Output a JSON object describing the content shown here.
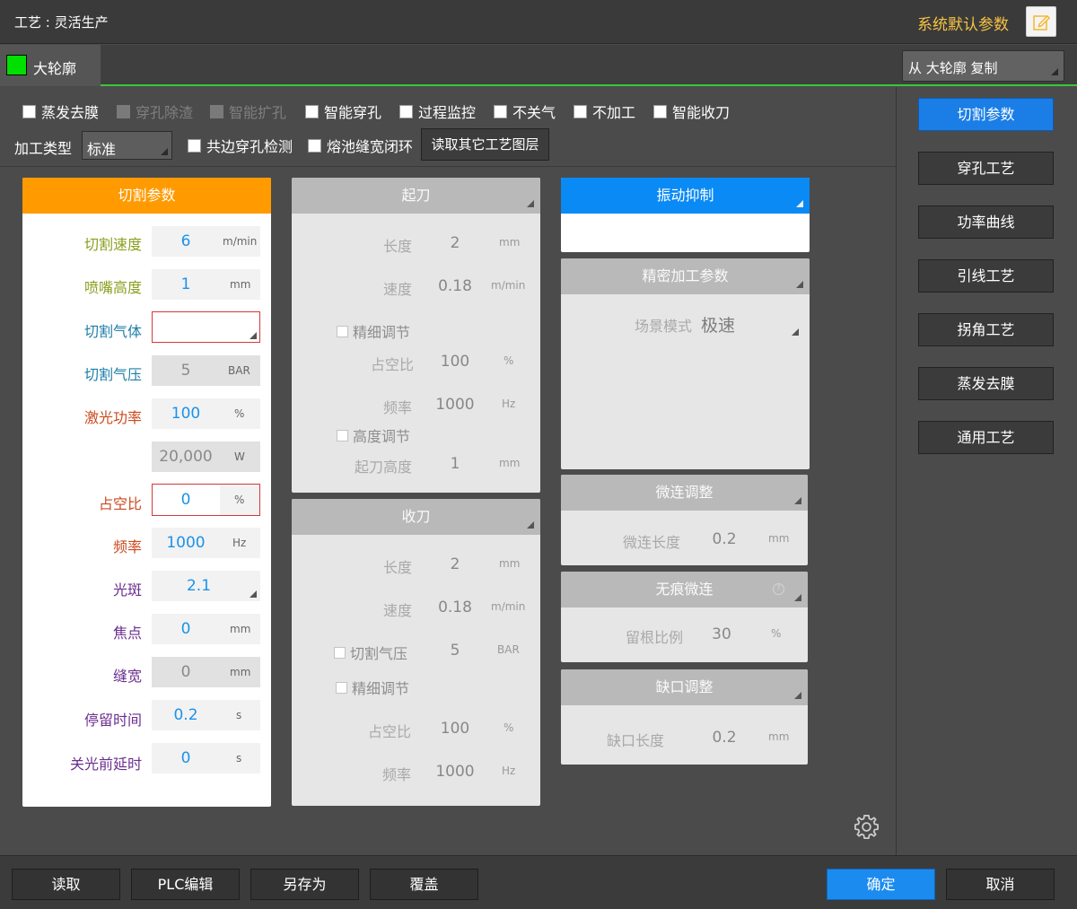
{
  "titlebar": {
    "title": "工艺 : 灵活生产",
    "system_default": "系统默认参数"
  },
  "layer": {
    "name": "大轮廓",
    "color": "#00e000",
    "copy_from": "从 大轮廓 复制"
  },
  "options": {
    "evaporate": "蒸发去膜",
    "pierce_slag": "穿孔除渣",
    "smart_expand": "智能扩孔",
    "smart_pierce": "智能穿孔",
    "process_monitor": "过程监控",
    "no_gas_off": "不关气",
    "no_process": "不加工",
    "smart_retract": "智能收刀",
    "process_type_label": "加工类型",
    "process_type_value": "标准",
    "common_edge": "共边穿孔检测",
    "pool_width_loop": "熔池缝宽闭环",
    "read_other_layer": "读取其它工艺图层"
  },
  "cut_params": {
    "header": "切割参数",
    "speed": {
      "label": "切割速度",
      "value": "6",
      "unit": "m/min"
    },
    "nozzle_height": {
      "label": "喷嘴高度",
      "value": "1",
      "unit": "mm"
    },
    "gas": {
      "label": "切割气体",
      "value": ""
    },
    "gas_pressure": {
      "label": "切割气压",
      "value": "5",
      "unit": "BAR"
    },
    "laser_power": {
      "label": "激光功率",
      "value": "100",
      "unit": "%"
    },
    "power_watts": {
      "value": "20,000",
      "unit": "W"
    },
    "duty": {
      "label": "占空比",
      "value": "0",
      "unit": "%"
    },
    "frequency": {
      "label": "频率",
      "value": "1000",
      "unit": "Hz"
    },
    "spot": {
      "label": "光斑",
      "value": "2.1"
    },
    "focus": {
      "label": "焦点",
      "value": "0",
      "unit": "mm"
    },
    "kerf": {
      "label": "缝宽",
      "value": "0",
      "unit": "mm"
    },
    "dwell": {
      "label": "停留时间",
      "value": "0.2",
      "unit": "s"
    },
    "pre_off_delay": {
      "label": "关光前延时",
      "value": "0",
      "unit": "s"
    }
  },
  "start_blade": {
    "header": "起刀",
    "length": {
      "label": "长度",
      "value": "2",
      "unit": "mm"
    },
    "speed": {
      "label": "速度",
      "value": "0.18",
      "unit": "m/min"
    },
    "fine_adjust": "精细调节",
    "duty": {
      "label": "占空比",
      "value": "100",
      "unit": "%"
    },
    "frequency": {
      "label": "频率",
      "value": "1000",
      "unit": "Hz"
    },
    "height_adjust": "高度调节",
    "start_height": {
      "label": "起刀高度",
      "value": "1",
      "unit": "mm"
    }
  },
  "end_blade": {
    "header": "收刀",
    "length": {
      "label": "长度",
      "value": "2",
      "unit": "mm"
    },
    "speed": {
      "label": "速度",
      "value": "0.18",
      "unit": "m/min"
    },
    "cut_pressure": {
      "label": "切割气压",
      "value": "5",
      "unit": "BAR"
    },
    "fine_adjust": "精细调节",
    "duty": {
      "label": "占空比",
      "value": "100",
      "unit": "%"
    },
    "frequency": {
      "label": "频率",
      "value": "1000",
      "unit": "Hz"
    }
  },
  "vibration": {
    "header": "振动抑制"
  },
  "precision": {
    "header": "精密加工参数",
    "scene_label": "场景模式",
    "scene_value": "极速"
  },
  "micro_joint": {
    "header": "微连调整",
    "label": "微连长度",
    "value": "0.2",
    "unit": "mm"
  },
  "seamless": {
    "header": "无痕微连",
    "label": "留根比例",
    "value": "30",
    "unit": "%"
  },
  "gap": {
    "header": "缺口调整",
    "label": "缺口长度",
    "value": "0.2",
    "unit": "mm"
  },
  "nav": [
    "切割参数",
    "穿孔工艺",
    "功率曲线",
    "引线工艺",
    "拐角工艺",
    "蒸发去膜",
    "通用工艺"
  ],
  "bottom": {
    "read": "读取",
    "plc": "PLC编辑",
    "save_as": "另存为",
    "overwrite": "覆盖",
    "ok": "确定",
    "cancel": "取消"
  }
}
